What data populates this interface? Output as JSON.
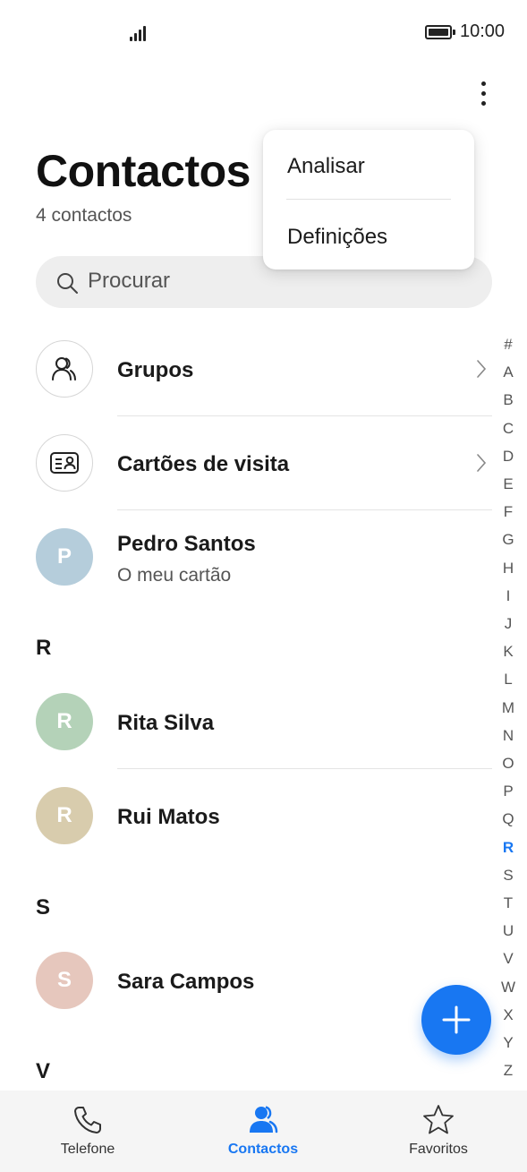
{
  "status_bar": {
    "time": "10:00"
  },
  "header": {
    "title": "Contactos",
    "count_label": "4 contactos"
  },
  "search": {
    "placeholder": "Procurar"
  },
  "menu": {
    "items": [
      {
        "label": "Analisar"
      },
      {
        "label": "Definições"
      }
    ]
  },
  "list": {
    "groups_label": "Grupos",
    "cards_label": "Cartões de visita",
    "my_card": {
      "initial": "P",
      "name": "Pedro Santos",
      "subtitle": "O meu cartão",
      "color": "#b5cddb"
    },
    "sections": [
      {
        "letter": "R",
        "contacts": [
          {
            "initial": "R",
            "name": "Rita Silva",
            "color": "#b4d2b8"
          },
          {
            "initial": "R",
            "name": "Rui Matos",
            "color": "#d8ccad"
          }
        ]
      },
      {
        "letter": "S",
        "contacts": [
          {
            "initial": "S",
            "name": "Sara Campos",
            "color": "#e6c7bd"
          }
        ]
      },
      {
        "letter": "V",
        "contacts": []
      }
    ]
  },
  "alphabet_index": [
    "#",
    "A",
    "B",
    "C",
    "D",
    "E",
    "F",
    "G",
    "H",
    "I",
    "J",
    "K",
    "L",
    "M",
    "N",
    "O",
    "P",
    "Q",
    "R",
    "S",
    "T",
    "U",
    "V",
    "W",
    "X",
    "Y",
    "Z"
  ],
  "alphabet_active": "R",
  "bottom_nav": {
    "items": [
      {
        "label": "Telefone",
        "icon": "phone-icon"
      },
      {
        "label": "Contactos",
        "icon": "contacts-icon",
        "active": true
      },
      {
        "label": "Favoritos",
        "icon": "star-icon"
      }
    ]
  },
  "colors": {
    "accent": "#1877f2"
  }
}
